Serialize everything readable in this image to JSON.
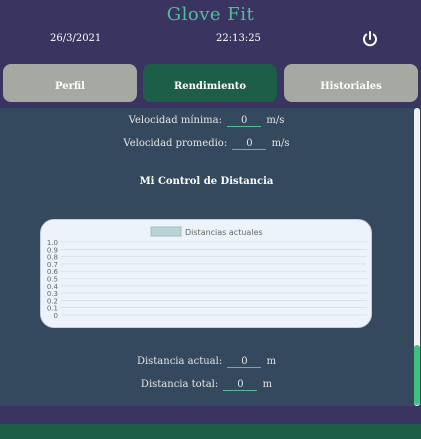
{
  "header": {
    "app_title": "Glove Fit",
    "date": "26/3/2021",
    "time": "22:13:25",
    "power_icon": "power-icon"
  },
  "tabs": [
    {
      "label": "Perfil",
      "active": false
    },
    {
      "label": "Rendimiento",
      "active": true
    },
    {
      "label": "Historiales",
      "active": false
    }
  ],
  "metrics": {
    "min_speed_label": "Velocidad mínima:",
    "min_speed_value": "0",
    "min_speed_unit": "m/s",
    "avg_speed_label": "Velocidad promedio:",
    "avg_speed_value": "0",
    "avg_speed_unit": "m/s"
  },
  "section_title": "Mi Control de Distancia",
  "chart_data": {
    "type": "line",
    "series": [
      {
        "name": "Distancias actuales",
        "values": []
      }
    ],
    "categories": [],
    "ylim": [
      0,
      1.0
    ],
    "y_ticks": [
      "1.0",
      "0.9",
      "0.8",
      "0.7",
      "0.6",
      "0.5",
      "0.4",
      "0.3",
      "0.2",
      "0.1",
      "0"
    ],
    "legend_position": "top",
    "grid": true,
    "colors": {
      "series": "#b9d3d6",
      "grid": "#cfd9e3"
    }
  },
  "distance": {
    "current_label": "Distancia actual:",
    "current_value": "0",
    "current_unit": "m",
    "total_label": "Distancia total:",
    "total_value": "0",
    "total_unit": "m"
  },
  "colors": {
    "header_bg": "#3a3560",
    "accent_green": "#4fbf9a",
    "active_tab": "#1c5e48",
    "inactive_tab": "#a5a9a2",
    "content_bg": "#34495e"
  }
}
